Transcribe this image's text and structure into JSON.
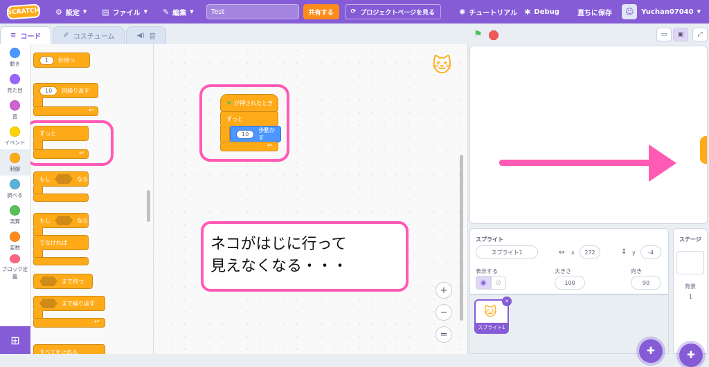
{
  "topbar": {
    "logo": "SCRATCH",
    "settings": "設定",
    "file": "ファイル",
    "edit": "編集",
    "title_value": "Test",
    "share": "共有する",
    "project_page": "プロジェクトページを見る",
    "tutorial": "チュートリアル",
    "debug": "Debug",
    "save_now": "直ちに保存",
    "username": "Yuchan07040"
  },
  "tabs": {
    "code": "コード",
    "costume": "コスチューム",
    "sound": "音"
  },
  "categories": [
    {
      "label": "動き",
      "color": "#4c97ff"
    },
    {
      "label": "見た目",
      "color": "#9966ff"
    },
    {
      "label": "音",
      "color": "#cf63cf"
    },
    {
      "label": "イベント",
      "color": "#ffd500"
    },
    {
      "label": "制御",
      "color": "#ffab19"
    },
    {
      "label": "調べる",
      "color": "#5cb1d6"
    },
    {
      "label": "演算",
      "color": "#59c059"
    },
    {
      "label": "変数",
      "color": "#ff8c1a"
    },
    {
      "label": "ブロック定義",
      "color": "#ff6680"
    }
  ],
  "palette": {
    "wait_num": "1",
    "wait": "秒待つ",
    "repeat_num": "10",
    "repeat": "回繰り返す",
    "forever": "ずっと",
    "if": "もし",
    "then": "なら",
    "if2": "もし",
    "then2": "なら",
    "else": "でなければ",
    "wait_until": "まで待つ",
    "repeat_until": "まで繰り返す",
    "stop_all": "すべてを止める"
  },
  "script": {
    "hat": "が押されたとき",
    "forever": "ずっと",
    "move_num": "10",
    "move": "歩動かす"
  },
  "note": {
    "line1": "ネコがはじに行って",
    "line2": "見えなくなる・・・"
  },
  "zoom": {
    "in": "+",
    "out": "−",
    "reset": "="
  },
  "sprite": {
    "header": "スプライト",
    "name": "スプライト1",
    "x_label": "x",
    "x": "272",
    "y_label": "y",
    "y": "-4",
    "show_label": "表示する",
    "size_label": "大きさ",
    "size": "100",
    "dir_label": "向き",
    "dir": "90",
    "thumb_label": "スプライト1"
  },
  "stage_panel": {
    "header": "ステージ",
    "backdrop_label": "背景",
    "backdrop_count": "1"
  }
}
